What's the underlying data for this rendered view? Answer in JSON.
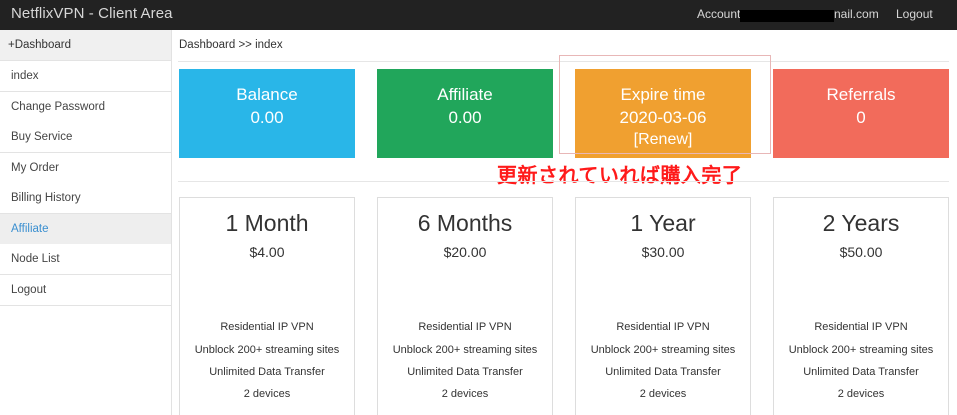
{
  "app": {
    "title": "NetflixVPN - Client Area",
    "account_label": "Account",
    "account_suffix": "nail.com",
    "logout": "Logout"
  },
  "sidebar": {
    "header": "+Dashboard",
    "items": [
      {
        "label": "index"
      },
      {
        "label": "Change Password"
      },
      {
        "label": "Buy Service"
      },
      {
        "label": "My Order"
      },
      {
        "label": "Billing History"
      },
      {
        "label": "Affiliate",
        "active": true
      },
      {
        "label": "Node List"
      },
      {
        "label": "Logout"
      }
    ]
  },
  "breadcrumb": "Dashboard >> index",
  "stats": [
    {
      "title": "Balance",
      "value": "0.00",
      "color": "#29b6e8"
    },
    {
      "title": "Affiliate",
      "value": "0.00",
      "color": "#21a65b"
    },
    {
      "title": "Expire time",
      "value": "2020-03-06",
      "link": "[Renew]",
      "color": "#f0a030"
    },
    {
      "title": "Referrals",
      "value": "0",
      "color": "#f26b5b"
    }
  ],
  "annotation": "更新されていれば購入完了",
  "plans": [
    {
      "name": "1 Month",
      "price": "$4.00",
      "features": [
        "Residential IP VPN",
        "Unblock 200+ streaming sites",
        "Unlimited Data Transfer",
        "2 devices"
      ]
    },
    {
      "name": "6 Months",
      "price": "$20.00",
      "features": [
        "Residential IP VPN",
        "Unblock 200+ streaming sites",
        "Unlimited Data Transfer",
        "2 devices"
      ]
    },
    {
      "name": "1 Year",
      "price": "$30.00",
      "features": [
        "Residential IP VPN",
        "Unblock 200+ streaming sites",
        "Unlimited Data Transfer",
        "2 devices"
      ]
    },
    {
      "name": "2 Years",
      "price": "$50.00",
      "features": [
        "Residential IP VPN",
        "Unblock 200+ streaming sites",
        "Unlimited Data Transfer",
        "2 devices"
      ]
    }
  ]
}
